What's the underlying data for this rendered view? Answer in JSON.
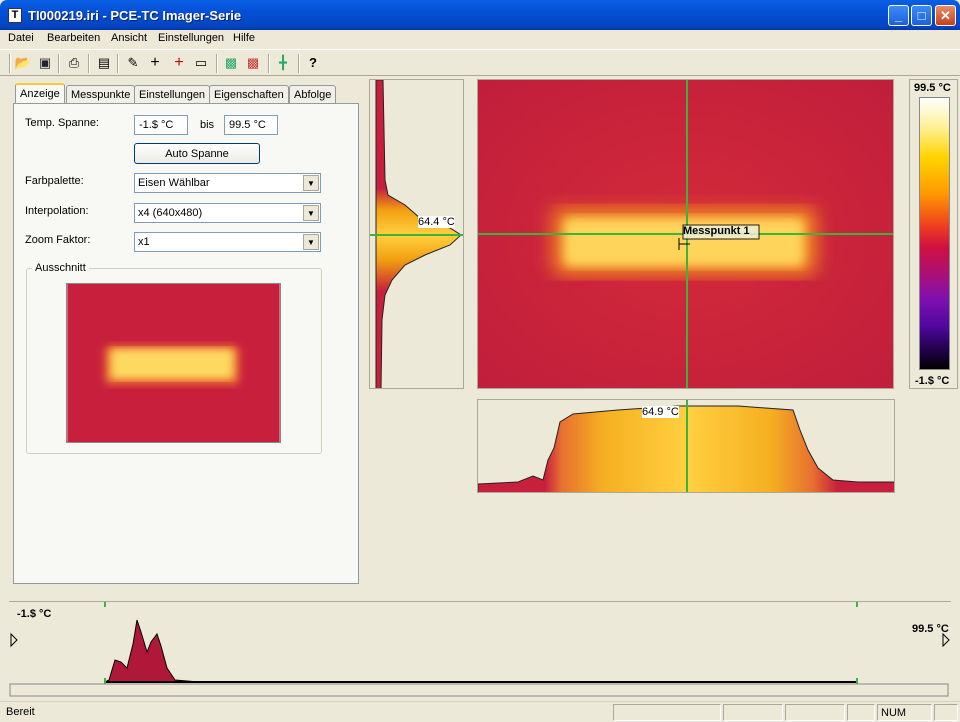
{
  "window": {
    "title": "TI000219.iri - PCE-TC Imager-Serie",
    "icon_letter": "T"
  },
  "menu": [
    "Datei",
    "Bearbeiten",
    "Ansicht",
    "Einstellungen",
    "Hilfe"
  ],
  "tabs": [
    "Anzeige",
    "Messpunkte",
    "Einstellungen",
    "Eigenschaften",
    "Abfolge"
  ],
  "display": {
    "temp_span_label": "Temp. Spanne:",
    "temp_min": "-1.$ °C",
    "bis_label": "bis",
    "temp_max": "99.5 °C",
    "auto_span_button": "Auto Spanne",
    "palette_label": "Farbpalette:",
    "palette_value": "Eisen Wählbar",
    "interpolation_label": "Interpolation:",
    "interpolation_value": "x4 (640x480)",
    "zoom_label": "Zoom Faktor:",
    "zoom_value": "x1",
    "crop_group_label": "Ausschnitt"
  },
  "thermal": {
    "vertical_profile_label": "64.4 °C",
    "horizontal_profile_label": "64.9 °C",
    "measure_point_label": "Messpunkt 1"
  },
  "scale": {
    "max": "99.5 °C",
    "min": "-1.$ °C"
  },
  "histogram": {
    "min": "-1.$ °C",
    "max": "99.5 °C"
  },
  "status": {
    "text": "Bereit",
    "num": "NUM"
  },
  "colors": {
    "background_red": "#C8203C",
    "hot_yellow": "#FFE060",
    "cursor_green": "#3CB43C"
  }
}
